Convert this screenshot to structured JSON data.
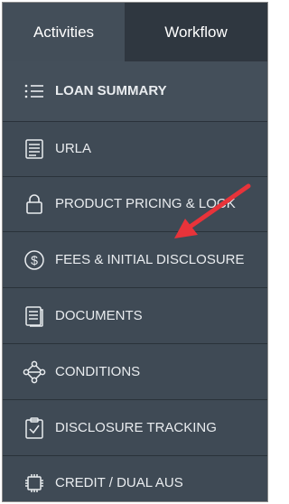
{
  "tabs": [
    {
      "label": "Activities",
      "active": false
    },
    {
      "label": "Workflow",
      "active": true
    }
  ],
  "menu": {
    "items": [
      {
        "label": "LOAN SUMMARY",
        "icon": "list-icon",
        "selected": true
      },
      {
        "label": "URLA",
        "icon": "form-icon"
      },
      {
        "label": "PRODUCT PRICING & LOCK",
        "icon": "lock-icon"
      },
      {
        "label": "FEES & INITIAL DISCLOSURE",
        "icon": "dollar-circle-icon"
      },
      {
        "label": "DOCUMENTS",
        "icon": "documents-icon"
      },
      {
        "label": "CONDITIONS",
        "icon": "conditions-network-icon"
      },
      {
        "label": "DISCLOSURE TRACKING",
        "icon": "clipboard-check-icon"
      },
      {
        "label": "CREDIT / DUAL AUS",
        "icon": "chip-icon"
      }
    ]
  },
  "annotation": {
    "type": "red-arrow",
    "points_to": "FEES & INITIAL DISCLOSURE",
    "color": "#e8333a"
  },
  "colors": {
    "panel": "#3f4a55",
    "workflow_tab": "#2f3740",
    "divider": "#2a323a",
    "text": "#e9ecef"
  }
}
